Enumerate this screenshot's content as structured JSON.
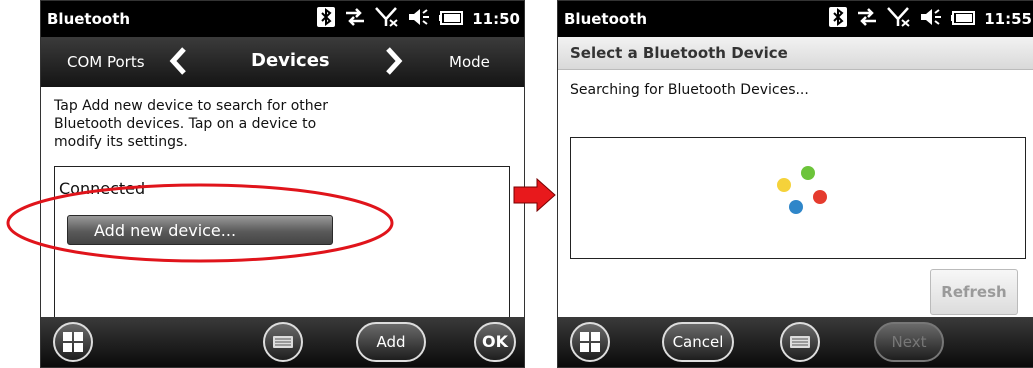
{
  "left_screen": {
    "status_title": "Bluetooth",
    "clock": "11:50",
    "nav": {
      "prev": "COM Ports",
      "current": "Devices",
      "next": "Mode"
    },
    "instructions": [
      "Tap Add new device to search for other",
      "Bluetooth devices. Tap on a device to",
      "modify its settings."
    ],
    "list_header": "Connected",
    "add_device_label": "Add new device...",
    "softkeys": {
      "add": "Add",
      "ok": "OK"
    }
  },
  "right_screen": {
    "status_title": "Bluetooth",
    "clock": "11:55",
    "subtitle": "Select a Bluetooth Device",
    "searching_text": "Searching for Bluetooth Devices...",
    "refresh_label": "Refresh",
    "softkeys": {
      "cancel": "Cancel",
      "next": "Next"
    }
  },
  "colors": {
    "arrow": "#e8191c",
    "highlight": "#e0141b",
    "spinner": [
      "#f5d23a",
      "#6cc43a",
      "#2f86c9",
      "#e53b2e"
    ]
  },
  "icons": [
    "bluetooth-icon",
    "sync-icon",
    "no-signal-icon",
    "volume-icon",
    "battery-icon",
    "windows-start-icon",
    "keyboard-icon"
  ]
}
